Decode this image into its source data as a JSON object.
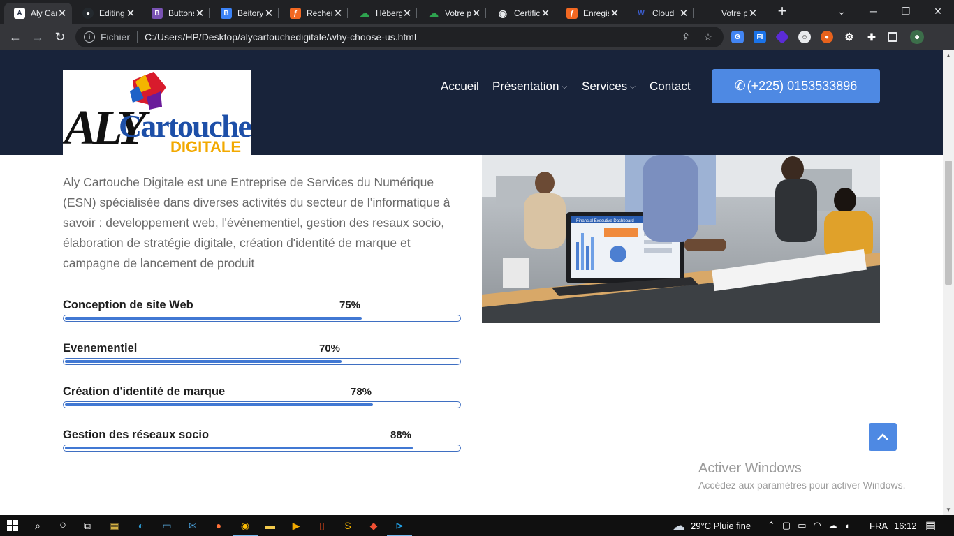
{
  "browser": {
    "tabs": [
      {
        "title": "Aly Cartouche Digitale",
        "favicon": "aly-logo-icon",
        "color": "#ffffff",
        "active": true
      },
      {
        "title": "Editing",
        "favicon": "github-icon",
        "color": "#24292e"
      },
      {
        "title": "Buttons",
        "favicon": "bootstrap-icon",
        "color": "#7952b3"
      },
      {
        "title": "Beitory",
        "favicon": "bootstrap-blue-icon",
        "color": "#3b82f6"
      },
      {
        "title": "Recherche",
        "favicon": "sf-icon",
        "color": "#f26822"
      },
      {
        "title": "Hébergement",
        "favicon": "cloud-green-icon",
        "color": "#2ea44f"
      },
      {
        "title": "Votre page",
        "favicon": "cloud-green-icon",
        "color": "#2ea44f"
      },
      {
        "title": "Certificat",
        "favicon": "globe-icon",
        "color": "#e8eaed"
      },
      {
        "title": "Enregistrer",
        "favicon": "sf-icon",
        "color": "#f26822"
      },
      {
        "title": "Cloud",
        "favicon": "wix-icon",
        "color": "#3b5ccc"
      },
      {
        "title": "Votre page",
        "favicon": "blank-icon",
        "color": "#202124"
      }
    ],
    "address": {
      "scheme_label": "Fichier",
      "url": "C:/Users/HP/Desktop/alycartouchedigitale/why-choose-us.html"
    }
  },
  "site": {
    "logo": {
      "word1": "ALY",
      "word2": "Cartouche",
      "word3": "DIGITALE"
    },
    "nav": [
      {
        "label": "Accueil",
        "dropdown": false
      },
      {
        "label": "Présentation",
        "dropdown": true
      },
      {
        "label": "Services",
        "dropdown": true
      },
      {
        "label": "Contact",
        "dropdown": false
      }
    ],
    "cta_phone": "(+225) 0153533896",
    "intro": "Aly Cartouche Digitale est une Entreprise de Services du Numérique (ESN) spécialisée dans diverses activités du secteur de l’informatique à savoir : developpement web, l'évènementiel, gestion des resaux socio, élaboration de stratégie digitale, création d'identité de marque et campagne de lancement de produit",
    "skills": [
      {
        "name": "Conception de site Web",
        "percent": 75,
        "label": "75%"
      },
      {
        "name": "Evenementiel",
        "percent": 70,
        "label": "70%"
      },
      {
        "name": "Création d'identité de marque",
        "percent": 78,
        "label": "78%"
      },
      {
        "name": "Gestion des réseaux socio",
        "percent": 88,
        "label": "88%"
      }
    ],
    "photo": {
      "screen_title": "Financial Executive Dashboard"
    }
  },
  "windows_activation": {
    "title": "Activer Windows",
    "subtitle": "Accédez aux paramètres pour activer Windows."
  },
  "taskbar": {
    "weather": "29°C  Pluie fine",
    "language": "FRA",
    "time": "16:12"
  },
  "colors": {
    "header_bg": "#18233a",
    "accent": "#4e89e3",
    "progress": "#4178d3"
  }
}
